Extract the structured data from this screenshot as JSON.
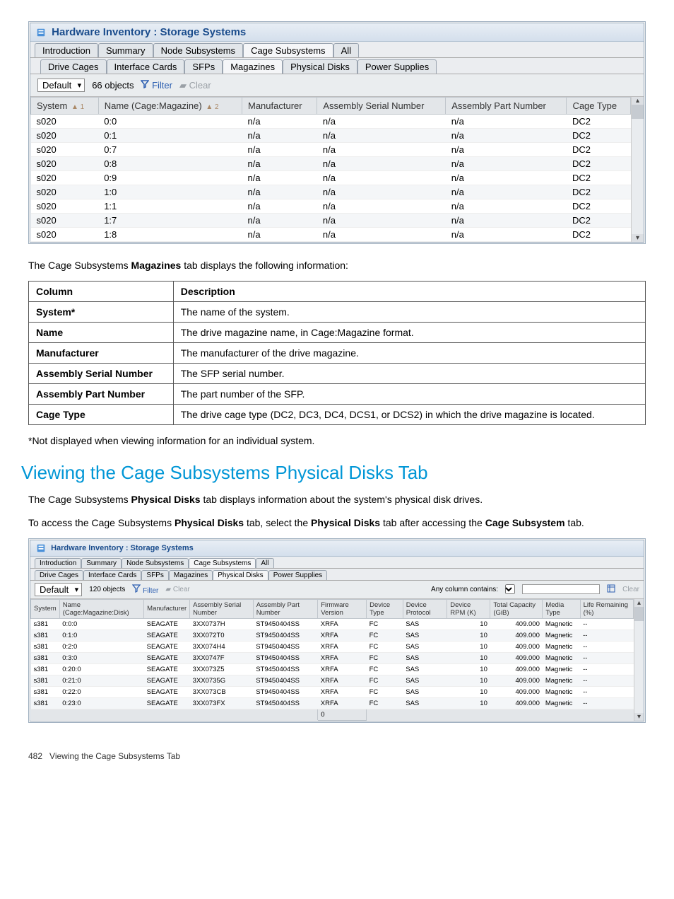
{
  "window1": {
    "title": "Hardware Inventory : Storage Systems",
    "tabrow1": [
      "Introduction",
      "Summary",
      "Node Subsystems",
      "Cage Subsystems",
      "All"
    ],
    "tabrow1_active": 3,
    "tabrow2": [
      "Drive Cages",
      "Interface Cards",
      "SFPs",
      "Magazines",
      "Physical Disks",
      "Power Supplies"
    ],
    "tabrow2_active": 3,
    "filter": {
      "combo": "Default",
      "count": "66 objects",
      "filter_label": "Filter",
      "clear_label": "Clear"
    },
    "columns": [
      {
        "label": "System",
        "sort": "1"
      },
      {
        "label": "Name (Cage:Magazine)",
        "sort": "2"
      },
      {
        "label": "Manufacturer"
      },
      {
        "label": "Assembly Serial Number"
      },
      {
        "label": "Assembly Part Number"
      },
      {
        "label": "Cage Type"
      }
    ],
    "rows": [
      {
        "c": [
          "s020",
          "0:0",
          "n/a",
          "n/a",
          "n/a",
          "DC2"
        ]
      },
      {
        "c": [
          "s020",
          "0:1",
          "n/a",
          "n/a",
          "n/a",
          "DC2"
        ]
      },
      {
        "c": [
          "s020",
          "0:7",
          "n/a",
          "n/a",
          "n/a",
          "DC2"
        ]
      },
      {
        "c": [
          "s020",
          "0:8",
          "n/a",
          "n/a",
          "n/a",
          "DC2"
        ]
      },
      {
        "c": [
          "s020",
          "0:9",
          "n/a",
          "n/a",
          "n/a",
          "DC2"
        ]
      },
      {
        "c": [
          "s020",
          "1:0",
          "n/a",
          "n/a",
          "n/a",
          "DC2"
        ]
      },
      {
        "c": [
          "s020",
          "1:1",
          "n/a",
          "n/a",
          "n/a",
          "DC2"
        ]
      },
      {
        "c": [
          "s020",
          "1:7",
          "n/a",
          "n/a",
          "n/a",
          "DC2"
        ]
      },
      {
        "c": [
          "s020",
          "1:8",
          "n/a",
          "n/a",
          "n/a",
          "DC2"
        ]
      }
    ]
  },
  "para_magazines": "The Cage Subsystems <b>Magazines</b> tab displays the following information:",
  "info_table": {
    "header": [
      "Column",
      "Description"
    ],
    "rows": [
      [
        "System*",
        "The name of the system."
      ],
      [
        "Name",
        "The drive magazine name, in Cage:Magazine format."
      ],
      [
        "Manufacturer",
        "The manufacturer of the drive magazine."
      ],
      [
        "Assembly Serial Number",
        "The SFP serial number."
      ],
      [
        "Assembly Part Number",
        "The part number of the SFP."
      ],
      [
        "Cage Type",
        "The drive cage type (DC2, DC3, DC4, DCS1, or DCS2) in which the drive magazine is located."
      ]
    ]
  },
  "footnote": "*Not displayed when viewing information for an individual system.",
  "section_heading": "Viewing the Cage Subsystems Physical Disks Tab",
  "para_pd1": "The Cage Subsystems <b>Physical Disks</b> tab displays information about the system's physical disk drives.",
  "para_pd2": "To access the Cage Subsystems <b>Physical Disks</b> tab, select the <b>Physical Disks</b> tab after accessing the <b>Cage Subsystem</b> tab.",
  "window2": {
    "title": "Hardware Inventory : Storage Systems",
    "tabrow1": [
      "Introduction",
      "Summary",
      "Node Subsystems",
      "Cage Subsystems",
      "All"
    ],
    "tabrow1_active": 3,
    "tabrow2": [
      "Drive Cages",
      "Interface Cards",
      "SFPs",
      "Magazines",
      "Physical Disks",
      "Power Supplies"
    ],
    "tabrow2_active": 4,
    "filter": {
      "combo": "Default",
      "count": "120 objects",
      "filter_label": "Filter",
      "clear_label": "Clear",
      "anycol": "Any column contains:"
    },
    "columns": [
      "System",
      "Name (Cage:Magazine:Disk)",
      "Manufacturer",
      "Assembly Serial Number",
      "Assembly Part Number",
      "Firmware Version",
      "Device Type",
      "Device Protocol",
      "Device RPM (K)",
      "Total Capacity (GiB)",
      "Media Type",
      "Life Remaining (%)"
    ],
    "rows": [
      {
        "c": [
          "s381",
          "0:0:0",
          "SEAGATE",
          "3XX0737H",
          "ST9450404SS",
          "XRFA",
          "FC",
          "SAS",
          "10",
          "409.000",
          "Magnetic",
          "--"
        ]
      },
      {
        "c": [
          "s381",
          "0:1:0",
          "SEAGATE",
          "3XX072T0",
          "ST9450404SS",
          "XRFA",
          "FC",
          "SAS",
          "10",
          "409.000",
          "Magnetic",
          "--"
        ]
      },
      {
        "c": [
          "s381",
          "0:2:0",
          "SEAGATE",
          "3XX074H4",
          "ST9450404SS",
          "XRFA",
          "FC",
          "SAS",
          "10",
          "409.000",
          "Magnetic",
          "--"
        ]
      },
      {
        "c": [
          "s381",
          "0:3:0",
          "SEAGATE",
          "3XX0747F",
          "ST9450404SS",
          "XRFA",
          "FC",
          "SAS",
          "10",
          "409.000",
          "Magnetic",
          "--"
        ]
      },
      {
        "c": [
          "s381",
          "0:20:0",
          "SEAGATE",
          "3XX073Z5",
          "ST9450404SS",
          "XRFA",
          "FC",
          "SAS",
          "10",
          "409.000",
          "Magnetic",
          "--"
        ]
      },
      {
        "c": [
          "s381",
          "0:21:0",
          "SEAGATE",
          "3XX0735G",
          "ST9450404SS",
          "XRFA",
          "FC",
          "SAS",
          "10",
          "409.000",
          "Magnetic",
          "--"
        ]
      },
      {
        "c": [
          "s381",
          "0:22:0",
          "SEAGATE",
          "3XX073CB",
          "ST9450404SS",
          "XRFA",
          "FC",
          "SAS",
          "10",
          "409.000",
          "Magnetic",
          "--"
        ]
      },
      {
        "c": [
          "s381",
          "0:23:0",
          "SEAGATE",
          "3XX073FX",
          "ST9450404SS",
          "XRFA",
          "FC",
          "SAS",
          "10",
          "409.000",
          "Magnetic",
          "--"
        ]
      }
    ],
    "footer_badge": "0"
  },
  "page_footer": {
    "num": "482",
    "text": "Viewing the Cage Subsystems Tab"
  }
}
